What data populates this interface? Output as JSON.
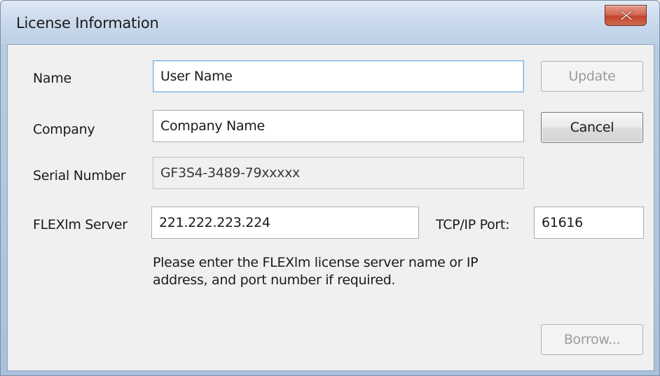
{
  "window": {
    "title": "License Information"
  },
  "icons": {
    "close": "close-icon"
  },
  "form": {
    "name_label": "Name",
    "name_value": "User Name",
    "company_label": "Company",
    "company_value": "Company Name",
    "serial_label": "Serial Number",
    "serial_value": "GF3S4-3489-79xxxxx",
    "server_label": "FLEXlm Server",
    "server_value": "221.222.223.224",
    "port_label": "TCP/IP Port:",
    "port_value": "61616",
    "hint": "Please enter the FLEXlm license server name or IP address, and port number if required."
  },
  "buttons": {
    "update": "Update",
    "cancel": "Cancel",
    "borrow": "Borrow..."
  },
  "state": {
    "focused_field": "name",
    "update_enabled": false,
    "borrow_enabled": false,
    "serial_readonly": true
  }
}
